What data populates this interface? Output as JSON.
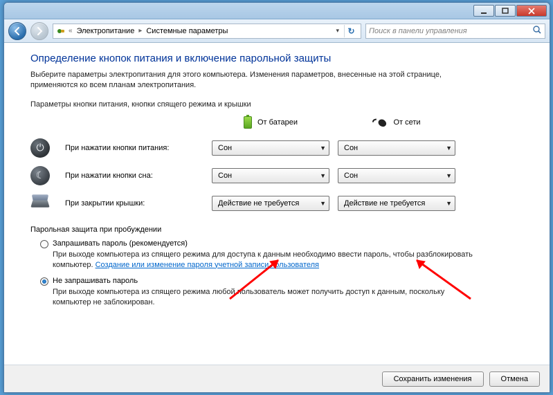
{
  "breadcrumb": {
    "level1": "Электропитание",
    "level2": "Системные параметры"
  },
  "search": {
    "placeholder": "Поиск в панели управления"
  },
  "heading": "Определение кнопок питания и включение парольной защиты",
  "intro": "Выберите параметры электропитания для этого компьютера. Изменения параметров, внесенные на этой странице, применяются ко всем планам электропитания.",
  "section1_label": "Параметры кнопки питания, кнопки спящего режима и крышки",
  "col_battery": "От батареи",
  "col_ac": "От сети",
  "rows": {
    "power": {
      "label": "При нажатии кнопки питания:",
      "battery": "Сон",
      "ac": "Сон"
    },
    "sleep": {
      "label": "При нажатии кнопки сна:",
      "battery": "Сон",
      "ac": "Сон"
    },
    "lid": {
      "label": "При закрытии крышки:",
      "battery": "Действие не требуется",
      "ac": "Действие не требуется"
    }
  },
  "section2_label": "Парольная защита при пробуждении",
  "radio_ask": {
    "label": "Запрашивать пароль (рекомендуется)",
    "desc_pre": "При выходе компьютера из спящего режима для доступа к данным необходимо ввести пароль, чтобы разблокировать компьютер. ",
    "link": "Создание или изменение пароля учетной записи пользователя"
  },
  "radio_noask": {
    "label": "Не запрашивать пароль",
    "desc": "При выходе компьютера из спящего режима любой пользователь может получить доступ к данным, поскольку компьютер не заблокирован."
  },
  "buttons": {
    "save": "Сохранить изменения",
    "cancel": "Отмена"
  }
}
